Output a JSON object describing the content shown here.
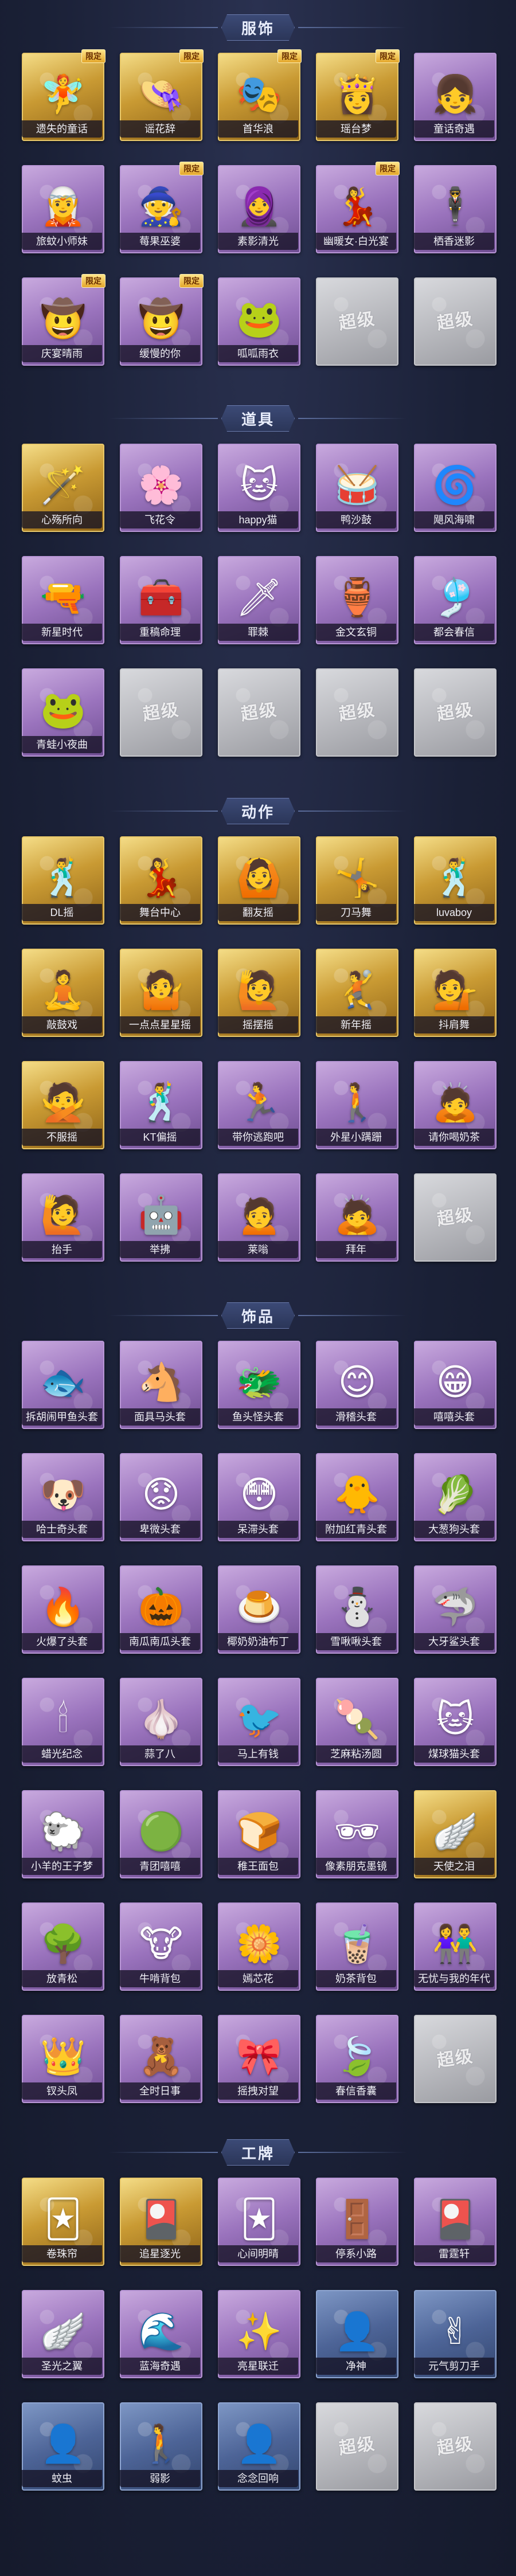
{
  "sections": [
    {
      "title": "服饰",
      "items": [
        {
          "label": "遗失的童话",
          "tier": "gold",
          "icon": "🧚",
          "badge": "限定"
        },
        {
          "label": "谣花辞",
          "tier": "gold",
          "icon": "👒",
          "badge": "限定"
        },
        {
          "label": "首华浪",
          "tier": "gold",
          "icon": "🎭",
          "badge": "限定"
        },
        {
          "label": "瑶台梦",
          "tier": "gold",
          "icon": "👸",
          "badge": "限定"
        },
        {
          "label": "童话奇遇",
          "tier": "purple",
          "icon": "👧",
          "badge": ""
        },
        {
          "label": "旅蚊小师妹",
          "tier": "purple",
          "icon": "🧝",
          "badge": ""
        },
        {
          "label": "莓果巫婆",
          "tier": "purple",
          "icon": "🧙",
          "badge": "限定"
        },
        {
          "label": "素影清光",
          "tier": "purple",
          "icon": "🧕",
          "badge": ""
        },
        {
          "label": "幽暖女·白光宴",
          "tier": "purple",
          "icon": "💃",
          "badge": "限定"
        },
        {
          "label": "栖香迷影",
          "tier": "purple",
          "icon": "🕴",
          "badge": ""
        },
        {
          "label": "庆宴晴雨",
          "tier": "purple",
          "icon": "🤠",
          "badge": "限定"
        },
        {
          "label": "缓慢的你",
          "tier": "purple",
          "icon": "🤠",
          "badge": "限定"
        },
        {
          "label": "呱呱雨衣",
          "tier": "purple",
          "icon": "🐸",
          "badge": ""
        },
        {
          "label": "",
          "tier": "gray",
          "icon": "超级",
          "badge": ""
        },
        {
          "label": "",
          "tier": "gray",
          "icon": "超级",
          "badge": ""
        }
      ]
    },
    {
      "title": "道具",
      "items": [
        {
          "label": "心殇所向",
          "tier": "gold",
          "icon": "🪄",
          "badge": ""
        },
        {
          "label": "飞花令",
          "tier": "purple",
          "icon": "🌸",
          "badge": ""
        },
        {
          "label": "happy猫",
          "tier": "purple",
          "icon": "🐱",
          "badge": ""
        },
        {
          "label": "鸭沙鼓",
          "tier": "purple",
          "icon": "🥁",
          "badge": ""
        },
        {
          "label": "飓风海啸",
          "tier": "purple",
          "icon": "🌀",
          "badge": ""
        },
        {
          "label": "新星时代",
          "tier": "purple",
          "icon": "🔫",
          "badge": ""
        },
        {
          "label": "重稿命理",
          "tier": "purple",
          "icon": "🧰",
          "badge": ""
        },
        {
          "label": "罪棘",
          "tier": "purple",
          "icon": "🗡",
          "badge": ""
        },
        {
          "label": "金文玄铜",
          "tier": "purple",
          "icon": "🏺",
          "badge": ""
        },
        {
          "label": "都会春信",
          "tier": "purple",
          "icon": "🎐",
          "badge": ""
        },
        {
          "label": "青蛙小夜曲",
          "tier": "purple",
          "icon": "🐸",
          "badge": ""
        },
        {
          "label": "",
          "tier": "gray",
          "icon": "超级",
          "badge": ""
        },
        {
          "label": "",
          "tier": "gray",
          "icon": "超级",
          "badge": ""
        },
        {
          "label": "",
          "tier": "gray",
          "icon": "超级",
          "badge": ""
        },
        {
          "label": "",
          "tier": "gray",
          "icon": "超级",
          "badge": ""
        }
      ]
    },
    {
      "title": "动作",
      "items": [
        {
          "label": "DL摇",
          "tier": "gold",
          "icon": "🕺",
          "badge": ""
        },
        {
          "label": "舞台中心",
          "tier": "gold",
          "icon": "💃",
          "badge": ""
        },
        {
          "label": "翻友摇",
          "tier": "gold",
          "icon": "🙆",
          "badge": ""
        },
        {
          "label": "刀马舞",
          "tier": "gold",
          "icon": "🤸",
          "badge": ""
        },
        {
          "label": "luvaboy",
          "tier": "gold",
          "icon": "🕺",
          "badge": ""
        },
        {
          "label": "敲鼓戏",
          "tier": "gold",
          "icon": "🧘",
          "badge": ""
        },
        {
          "label": "一点点星星摇",
          "tier": "gold",
          "icon": "🤷",
          "badge": ""
        },
        {
          "label": "摇摆摇",
          "tier": "gold",
          "icon": "🙋",
          "badge": ""
        },
        {
          "label": "新年摇",
          "tier": "gold",
          "icon": "🤾",
          "badge": ""
        },
        {
          "label": "抖肩舞",
          "tier": "gold",
          "icon": "💁",
          "badge": ""
        },
        {
          "label": "不服摇",
          "tier": "gold",
          "icon": "🙅",
          "badge": ""
        },
        {
          "label": "KT偏摇",
          "tier": "purple",
          "icon": "🕺",
          "badge": ""
        },
        {
          "label": "带你逃跑吧",
          "tier": "purple",
          "icon": "🏃",
          "badge": ""
        },
        {
          "label": "外星小蹒跚",
          "tier": "purple",
          "icon": "🚶",
          "badge": ""
        },
        {
          "label": "请你喝奶茶",
          "tier": "purple",
          "icon": "🙇",
          "badge": ""
        },
        {
          "label": "抬手",
          "tier": "purple",
          "icon": "🙋",
          "badge": ""
        },
        {
          "label": "举拂",
          "tier": "purple",
          "icon": "🤖",
          "badge": ""
        },
        {
          "label": "莱嗡",
          "tier": "purple",
          "icon": "🙍",
          "badge": ""
        },
        {
          "label": "拜年",
          "tier": "purple",
          "icon": "🙇",
          "badge": ""
        },
        {
          "label": "",
          "tier": "gray",
          "icon": "超级",
          "badge": ""
        }
      ]
    },
    {
      "title": "饰品",
      "items": [
        {
          "label": "拆胡闹甲鱼头套",
          "tier": "purple",
          "icon": "🐟",
          "badge": ""
        },
        {
          "label": "面具马头套",
          "tier": "purple",
          "icon": "🐴",
          "badge": ""
        },
        {
          "label": "鱼头怪头套",
          "tier": "purple",
          "icon": "🐲",
          "badge": ""
        },
        {
          "label": "滑稽头套",
          "tier": "purple",
          "icon": "😊",
          "badge": ""
        },
        {
          "label": "嘻嘻头套",
          "tier": "purple",
          "icon": "😁",
          "badge": ""
        },
        {
          "label": "哈士奇头套",
          "tier": "purple",
          "icon": "🐶",
          "badge": ""
        },
        {
          "label": "卑微头套",
          "tier": "purple",
          "icon": "😟",
          "badge": ""
        },
        {
          "label": "呆滞头套",
          "tier": "purple",
          "icon": "😳",
          "badge": ""
        },
        {
          "label": "附加红青头套",
          "tier": "purple",
          "icon": "🐥",
          "badge": ""
        },
        {
          "label": "大葱狗头套",
          "tier": "purple",
          "icon": "🥬",
          "badge": ""
        },
        {
          "label": "火爆了头套",
          "tier": "purple",
          "icon": "🔥",
          "badge": ""
        },
        {
          "label": "南瓜南瓜头套",
          "tier": "purple",
          "icon": "🎃",
          "badge": ""
        },
        {
          "label": "椰奶奶油布丁",
          "tier": "purple",
          "icon": "🍮",
          "badge": ""
        },
        {
          "label": "雪啾啾头套",
          "tier": "purple",
          "icon": "⛄",
          "badge": ""
        },
        {
          "label": "大牙鲨头套",
          "tier": "purple",
          "icon": "🦈",
          "badge": ""
        },
        {
          "label": "蜡光纪念",
          "tier": "purple",
          "icon": "🕯",
          "badge": ""
        },
        {
          "label": "蒜了八",
          "tier": "purple",
          "icon": "🧄",
          "badge": ""
        },
        {
          "label": "马上有钱",
          "tier": "purple",
          "icon": "🐦",
          "badge": ""
        },
        {
          "label": "芝麻粘汤圆",
          "tier": "purple",
          "icon": "🍡",
          "badge": ""
        },
        {
          "label": "煤球猫头套",
          "tier": "purple",
          "icon": "🐱",
          "badge": ""
        },
        {
          "label": "小羊的王子梦",
          "tier": "purple",
          "icon": "🐑",
          "badge": ""
        },
        {
          "label": "青团嘻嘻",
          "tier": "purple",
          "icon": "🟢",
          "badge": ""
        },
        {
          "label": "稚王面包",
          "tier": "purple",
          "icon": "🍞",
          "badge": ""
        },
        {
          "label": "像素朋克墨镜",
          "tier": "purple",
          "icon": "🕶",
          "badge": ""
        },
        {
          "label": "天使之泪",
          "tier": "gold",
          "icon": "🪽",
          "badge": ""
        },
        {
          "label": "放青松",
          "tier": "purple",
          "icon": "🌳",
          "badge": ""
        },
        {
          "label": "牛啃背包",
          "tier": "purple",
          "icon": "🐮",
          "badge": ""
        },
        {
          "label": "嫣芯花",
          "tier": "purple",
          "icon": "🌼",
          "badge": ""
        },
        {
          "label": "奶茶背包",
          "tier": "purple",
          "icon": "🧋",
          "badge": ""
        },
        {
          "label": "无忧与我的年代",
          "tier": "purple",
          "icon": "👫",
          "badge": ""
        },
        {
          "label": "钗头凤",
          "tier": "purple",
          "icon": "👑",
          "badge": ""
        },
        {
          "label": "全时日事",
          "tier": "purple",
          "icon": "🧸",
          "badge": ""
        },
        {
          "label": "摇拽对望",
          "tier": "purple",
          "icon": "🎀",
          "badge": ""
        },
        {
          "label": "春信香囊",
          "tier": "purple",
          "icon": "🍃",
          "badge": ""
        },
        {
          "label": "",
          "tier": "gray",
          "icon": "超级",
          "badge": ""
        }
      ]
    },
    {
      "title": "工牌",
      "items": [
        {
          "label": "卷珠帘",
          "tier": "gold",
          "icon": "🃏",
          "badge": ""
        },
        {
          "label": "追星逐光",
          "tier": "gold",
          "icon": "🎴",
          "badge": ""
        },
        {
          "label": "心间明晴",
          "tier": "purple",
          "icon": "🃏",
          "badge": ""
        },
        {
          "label": "停系小路",
          "tier": "purple",
          "icon": "🚪",
          "badge": ""
        },
        {
          "label": "雷霆轩",
          "tier": "purple",
          "icon": "🎴",
          "badge": ""
        },
        {
          "label": "圣光之翼",
          "tier": "purple",
          "icon": "🪽",
          "badge": ""
        },
        {
          "label": "蓝海奇遇",
          "tier": "purple",
          "icon": "🌊",
          "badge": ""
        },
        {
          "label": "亮星联迁",
          "tier": "purple",
          "icon": "✨",
          "badge": ""
        },
        {
          "label": "净神",
          "tier": "blue",
          "icon": "👤",
          "badge": ""
        },
        {
          "label": "元气剪刀手",
          "tier": "blue",
          "icon": "✌",
          "badge": ""
        },
        {
          "label": "蚊虫",
          "tier": "blue",
          "icon": "👤",
          "badge": ""
        },
        {
          "label": "弱影",
          "tier": "blue",
          "icon": "🚶",
          "badge": ""
        },
        {
          "label": "念念回响",
          "tier": "blue",
          "icon": "👤",
          "badge": ""
        },
        {
          "label": "",
          "tier": "gray",
          "icon": "超级",
          "badge": ""
        },
        {
          "label": "",
          "tier": "gray",
          "icon": "超级",
          "badge": ""
        }
      ]
    }
  ]
}
